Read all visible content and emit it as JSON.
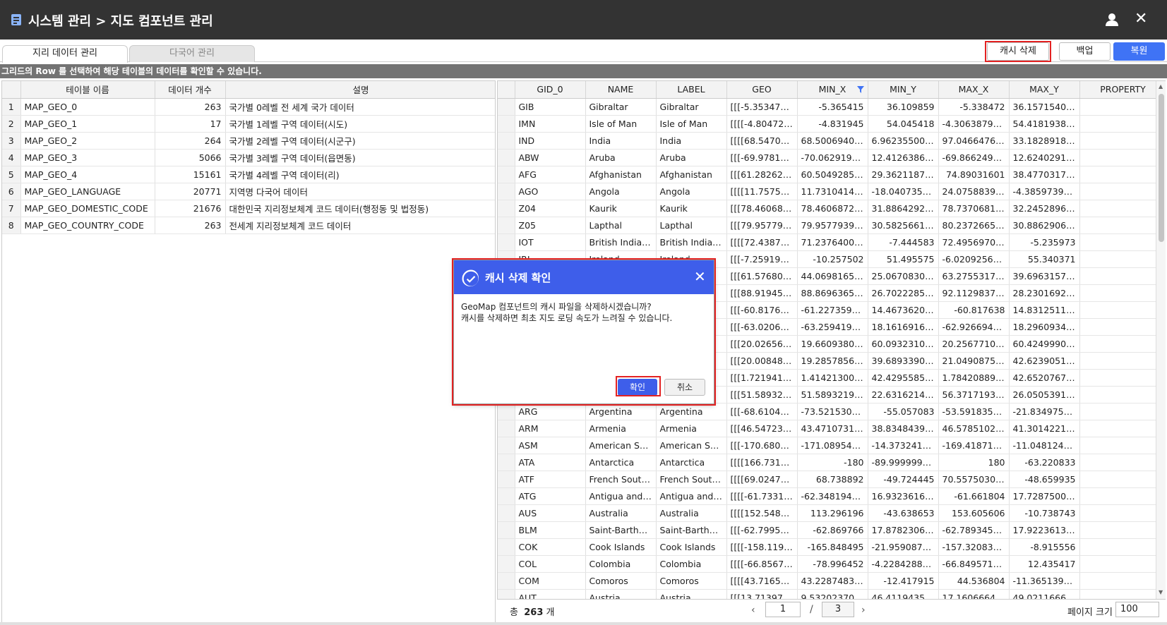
{
  "window": {
    "title": "시스템 관리 > 지도 컴포넌트 관리",
    "user_icon": "user-icon",
    "close_icon": "close-icon",
    "close_glyph": "✕"
  },
  "tabs": [
    {
      "label": "지리 데이터 관리",
      "active": true
    },
    {
      "label": "다국어 관리",
      "active": false
    }
  ],
  "toolbar": {
    "cache_delete": "캐시 삭제",
    "backup": "백업",
    "restore": "복원"
  },
  "info_text": "그리드의 Row 를 선택하여 해당 테이블의 데이터를 확인할 수 있습니다.",
  "left_grid": {
    "columns": [
      "테이블 이름",
      "데이터 개수",
      "설명"
    ],
    "rows": [
      {
        "no": "1",
        "name": "MAP_GEO_0",
        "count": "263",
        "desc": "국가별 0레벨 전 세계 국가 데이터"
      },
      {
        "no": "2",
        "name": "MAP_GEO_1",
        "count": "17",
        "desc": "국가별 1레벨 구역 데이터(시도)"
      },
      {
        "no": "3",
        "name": "MAP_GEO_2",
        "count": "264",
        "desc": "국가별 2레벨 구역 데이터(시군구)"
      },
      {
        "no": "4",
        "name": "MAP_GEO_3",
        "count": "5066",
        "desc": "국가별 3레벨 구역 데이터(읍면동)"
      },
      {
        "no": "5",
        "name": "MAP_GEO_4",
        "count": "15161",
        "desc": "국가별 4레벨 구역 데이터(리)"
      },
      {
        "no": "6",
        "name": "MAP_GEO_LANGUAGE",
        "count": "20771",
        "desc": "지역명 다국어 데이터"
      },
      {
        "no": "7",
        "name": "MAP_GEO_DOMESTIC_CODE",
        "count": "21676",
        "desc": "대한민국 지리정보체계 코드 데이터(행정동 및 법정동)"
      },
      {
        "no": "8",
        "name": "MAP_GEO_COUNTRY_CODE",
        "count": "263",
        "desc": "전세계 지리정보체계 코드 데이터"
      }
    ]
  },
  "right_grid": {
    "columns": [
      "GID_0",
      "NAME",
      "LABEL",
      "GEO",
      "MIN_X",
      "MIN_Y",
      "MAX_X",
      "MAX_Y",
      "PROPERTY"
    ],
    "filter_icon": "filter-icon",
    "rows": [
      [
        "GIB",
        "Gibraltar",
        "Gibraltar",
        "[[[-5.353473186...",
        "-5.365415",
        "36.109859",
        "-5.338472",
        "36.1571540830..."
      ],
      [
        "IMN",
        "Isle of Man",
        "Isle of Man",
        "[[[[-4.804723,54...",
        "-4.831945",
        "54.045418",
        "-4.30638790199...",
        "54.4181938170..."
      ],
      [
        "IND",
        "India",
        "India",
        "[[[[68.54708524...",
        "68.5006940000...",
        "6.96235500000...",
        "97.0466476650...",
        "33.1828918460..."
      ],
      [
        "ABW",
        "Aruba",
        "Aruba",
        "[[[-69.97819519...",
        "-70.062919617",
        "12.412638665",
        "-69.8662490849...",
        "12.6240291600..."
      ],
      [
        "AFG",
        "Afghanistan",
        "Afghanistan",
        "[[[61.282627426...",
        "60.5049285890...",
        "29.3621187210...",
        "74.89031601",
        "38.477031708"
      ],
      [
        "AGO",
        "Angola",
        "Angola",
        "[[[[11.75755119...",
        "11.7310414320...",
        "-18.0407352449...",
        "24.0758839390...",
        "-4.38597392999..."
      ],
      [
        "Z04",
        "Kaurik",
        "Kaurik",
        "[[[78.460687230...",
        "78.4606872300...",
        "31.8864292650...",
        "78.7370681780...",
        "32.2452896691..."
      ],
      [
        "Z05",
        "Lapthal",
        "Lapthal",
        "[[[79.957793944...",
        "79.9577939448...",
        "30.5825661220...",
        "80.2372665390...",
        "30.8862906733..."
      ],
      [
        "IOT",
        "British Indian O...",
        "British Indian O...",
        "[[[[72.43875099...",
        "71.2376400000...",
        "-7.444583",
        "72.4956970000...",
        "-5.235973"
      ],
      [
        "IRL",
        "Ireland",
        "Ireland",
        "[[[-7.259196,55....",
        "-10.257502",
        "51.495575",
        "-6.02092566499...",
        "55.340371"
      ],
      [
        "",
        "",
        "",
        "[[[61.576805,25...",
        "44.069816589",
        "25.0670830000...",
        "63.2755317650...",
        "39.6963157650..."
      ],
      [
        "",
        "",
        "",
        "[[[88.919456482...",
        "88.8696365350...",
        "26.7022285470...",
        "92.1129837040...",
        "28.2301692960..."
      ],
      [
        "",
        "",
        "",
        "[[[-60.817638,1...",
        "-61.227359771",
        "14.4673620000...",
        "-60.817638",
        "14.8312511440..."
      ],
      [
        "",
        "",
        "",
        "[[[-63.0206382...",
        "-63.2594198339...",
        "18.161691682",
        "-62.9266946159...",
        "18.2960934640..."
      ],
      [
        "",
        "",
        "",
        "[[[20.026562001...",
        "19.6609380010...",
        "60.0932310000...",
        "20.2567710010...",
        "60.4249990010..."
      ],
      [
        "",
        "",
        "",
        "[[[20.008482816...",
        "19.2857856750...",
        "39.6893390000...",
        "21.049087524",
        "42.6239051830..."
      ],
      [
        "",
        "",
        "",
        "[[[1.7219419490...",
        "1.41421300200...",
        "42.4295585030...",
        "1.78420889400...",
        "42.652076722"
      ],
      [
        "",
        "",
        "...m...",
        "[[[51.589321951...",
        "51.589321951",
        "22.631621401",
        "56.3717193600...",
        "26.0505391083..."
      ],
      [
        "ARG",
        "Argentina",
        "Argentina",
        "[[[-68.6104704...",
        "-73.5215306819...",
        "-55.057083",
        "-53.591835021",
        "-21.8349750199..."
      ],
      [
        "ARM",
        "Armenia",
        "Armenia",
        "[[[46.547237396...",
        "43.4710731500...",
        "38.8348439034...",
        "46.5785102840...",
        "41.3014221190..."
      ],
      [
        "ASM",
        "American Sam...",
        "American Sam...",
        "[[[-170.680638...",
        "-171.089547294",
        "-14.373241822",
        "-169.418712192",
        "-11.0481246709..."
      ],
      [
        "ATA",
        "Antarctica",
        "Antarctica",
        "[[[[166.7312470...",
        "-180",
        "-89.9999999999...",
        "180",
        "-63.220833"
      ],
      [
        "ATF",
        "French Souther...",
        "French Souther...",
        "[[[[69.024734000...",
        "68.738892",
        "-49.724445",
        "70.5575030000...",
        "-48.659935"
      ],
      [
        "ATG",
        "Antigua and Ba...",
        "Antigua and Ba...",
        "[[[[-61.733196,1...",
        "-62.348194123",
        "16.9323616030...",
        "-61.661804",
        "17.7287500000..."
      ],
      [
        "AUS",
        "Australia",
        "Australia",
        "[[[[152.5482030...",
        "113.296196",
        "-43.638653",
        "153.605606",
        "-10.738743"
      ],
      [
        "BLM",
        "Saint-Barthélemy",
        "Saint-Barthélemy",
        "[[[-62.79950389...",
        "-62.869766",
        "17.8782306730...",
        "-62.7893455549...",
        "17.922361374"
      ],
      [
        "COK",
        "Cook Islands",
        "Cook Islands",
        "[[[[-158.119171...",
        "-165.848495",
        "-21.9590873709...",
        "-157.320831298",
        "-8.915556"
      ],
      [
        "COL",
        "Colombia",
        "Colombia",
        "[[[[-66.85674633...",
        "-78.996452",
        "-4.22842884099...",
        "-66.8495712289...",
        "12.435417"
      ],
      [
        "COM",
        "Comoros",
        "Comoros",
        "[[[[43.71652600...",
        "43.2287483220...",
        "-12.417915",
        "44.536804",
        "-11.365139007"
      ],
      [
        "AUT",
        "Austria",
        "Austria",
        "[[[13.713975675...",
        "9.53202370412...",
        "46.4119435940...",
        "17.1606664885...",
        "49.0211666120..."
      ]
    ]
  },
  "footer": {
    "total_label": "총",
    "total_count": "263",
    "total_unit": "개",
    "prev_glyph": "‹",
    "next_glyph": "›",
    "current_page": "1",
    "separator": "/",
    "total_pages": "3",
    "page_size_label": "페이지 크기",
    "page_size": "100"
  },
  "dialog": {
    "title": "캐시 삭제 확인",
    "icon": "check-circle-icon",
    "close_glyph": "✕",
    "line1": "GeoMap 컴포넌트의 캐시 파일을 삭제하시겠습니까?",
    "line2": "캐시를 삭제하면 최초 지도 로딩 속도가 느려질 수 있습니다.",
    "confirm": "확인",
    "cancel": "취소"
  },
  "colors": {
    "titlebar_bg": "#333333",
    "primary": "#3f73f5",
    "dialog_header": "#3e5eea",
    "highlight": "#e32222",
    "info_bar": "#737373"
  }
}
